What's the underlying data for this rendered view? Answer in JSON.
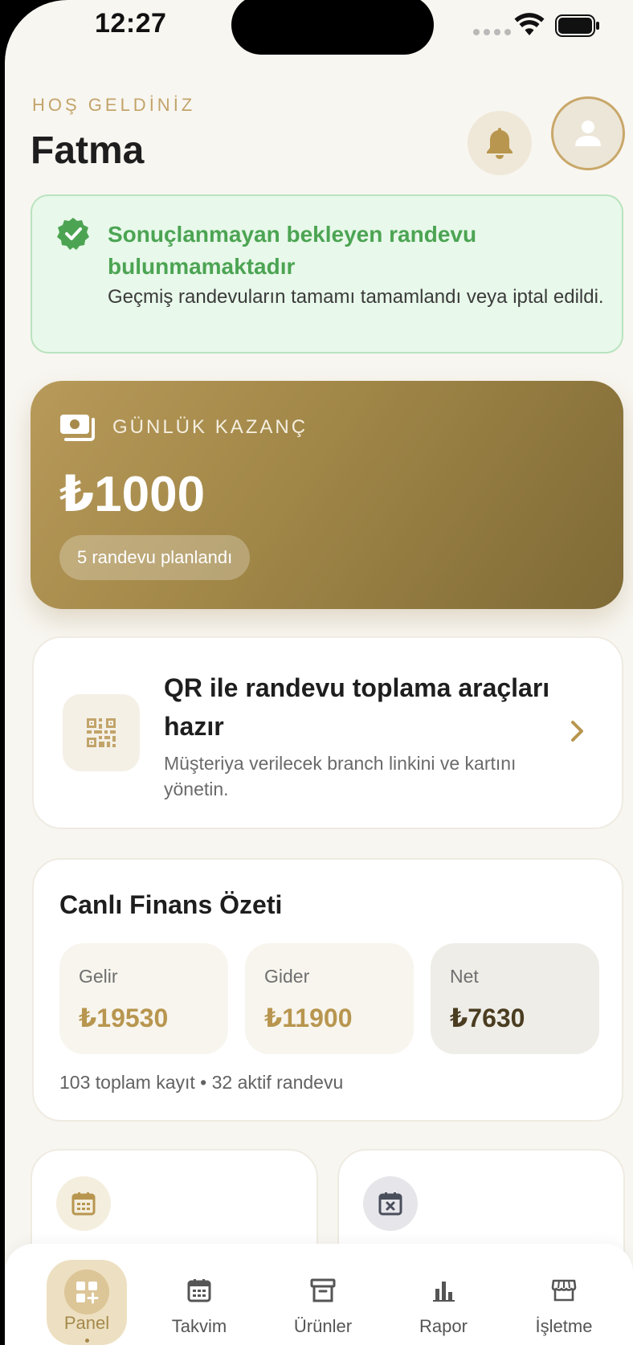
{
  "status_bar": {
    "time": "12:27"
  },
  "header": {
    "welcome": "HOŞ GELDİNİZ",
    "user_name": "Fatma"
  },
  "alert": {
    "title": "Sonuçlanmayan bekleyen randevu bulunmamaktadır",
    "text": "Geçmiş randevuların tamamı tamamlandı veya iptal edildi."
  },
  "earnings": {
    "label": "GÜNLÜK KAZANÇ",
    "amount": "₺1000",
    "pill": "5 randevu planlandı"
  },
  "qr": {
    "title": "QR ile randevu toplama araçları hazır",
    "description": "Müşteriya verilecek branch linkini ve kartını yönetin."
  },
  "finance": {
    "title": "Canlı Finans Özeti",
    "tiles": [
      {
        "label": "Gelir",
        "value": "₺19530"
      },
      {
        "label": "Gider",
        "value": "₺11900"
      },
      {
        "label": "Net",
        "value": "₺7630"
      }
    ],
    "footer": "103 toplam kayıt • 32 aktif randevu"
  },
  "tabs": [
    {
      "label": "Panel",
      "icon": "dashboard-add-icon"
    },
    {
      "label": "Takvim",
      "icon": "calendar-icon"
    },
    {
      "label": "Ürünler",
      "icon": "archive-box-icon"
    },
    {
      "label": "Rapor",
      "icon": "bar-chart-icon"
    },
    {
      "label": "İşletme",
      "icon": "storefront-icon"
    }
  ],
  "colors": {
    "accent": "#b8964f",
    "background": "#f8f6f1",
    "success": "#4ca453",
    "success_bg": "#e8f8ea"
  }
}
